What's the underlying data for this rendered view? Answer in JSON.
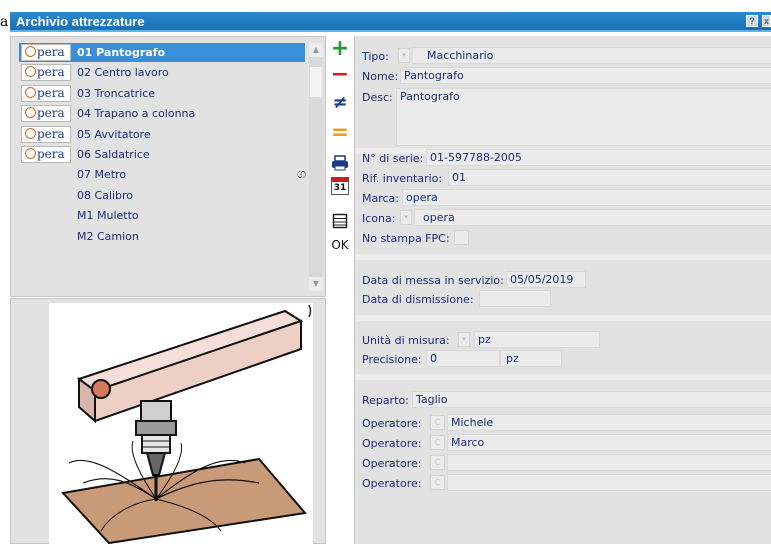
{
  "background_text": "a",
  "window": {
    "title": "Archivio attrezzature",
    "help_label": "?",
    "close_label": "x"
  },
  "list": {
    "logo_text": "pera",
    "items": [
      {
        "label": "01 Pantografo",
        "has_logo": true,
        "selected": true
      },
      {
        "label": "02 Centro lavoro",
        "has_logo": true
      },
      {
        "label": "03 Troncatrice",
        "has_logo": true
      },
      {
        "label": "04 Trapano a colonna",
        "has_logo": true
      },
      {
        "label": "05 Avvitatore",
        "has_logo": true
      },
      {
        "label": "06 Saldatrice",
        "has_logo": true
      },
      {
        "label": "07 Metro",
        "has_logo": false
      },
      {
        "label": "08 Calibro",
        "has_logo": false
      },
      {
        "label": "M1 Muletto",
        "has_logo": false
      },
      {
        "label": "M2 Camion",
        "has_logo": false
      }
    ],
    "scroll_up": "▲",
    "scroll_down": "▼",
    "settings_mark": "ග"
  },
  "toolbar": {
    "add_label": "+",
    "remove_label": "−",
    "compare_label": "≠",
    "equal_label": "=",
    "calendar_label": "31",
    "ok_label": "OK",
    "colors": {
      "add": "#1e9e2c",
      "remove": "#d61f1f",
      "compare": "#1a3a8a",
      "equal": "#f0a020"
    }
  },
  "form": {
    "tipo_label": "Tipo:",
    "tipo_value": "Macchinario",
    "nome_label": "Nome:",
    "nome_value": "Pantografo",
    "desc_label": "Desc:",
    "desc_value": "Pantografo",
    "serie_label": "N° di serie:",
    "serie_value": "01-597788-2005",
    "inventario_label": "Rif. inventario:",
    "inventario_value": "01",
    "marca_label": "Marca:",
    "marca_value": "opera",
    "icona_label": "Icona:",
    "icona_value": "opera",
    "nostampa_label": "No stampa FPC:",
    "data_servizio_label": "Data di messa in servizio:",
    "data_servizio_value": "05/05/2019",
    "data_dismissione_label": "Data di dismissione:",
    "data_dismissione_value": "",
    "unita_label": "Unità di misura:",
    "unita_value": "pz",
    "precisione_label": "Precisione:",
    "precisione_value": "0",
    "precisione_unit": "pz",
    "reparto_label": "Reparto:",
    "reparto_value": "Taglio",
    "operatore_label": "Operatore:",
    "operatori": [
      "Michele",
      "Marco",
      "",
      ""
    ],
    "dropdown_glyph": "▾",
    "clear_glyph": "C"
  }
}
